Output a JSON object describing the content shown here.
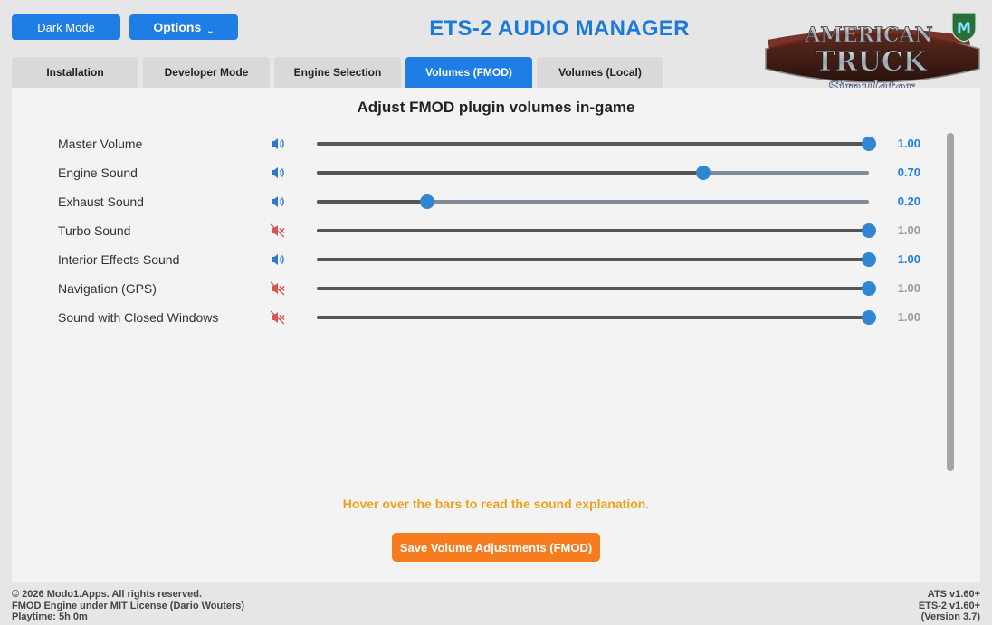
{
  "header": {
    "dark_mode_label": "Dark Mode",
    "options_label": "Options",
    "title": "ETS-2 AUDIO MANAGER",
    "logo": {
      "line1": "AMERICAN",
      "line2": "TRUCK",
      "line3": "Simulator",
      "badge": "M"
    }
  },
  "tabs": [
    {
      "label": "Installation",
      "active": false
    },
    {
      "label": "Developer Mode",
      "active": false
    },
    {
      "label": "Engine Selection",
      "active": false
    },
    {
      "label": "Volumes (FMOD)",
      "active": true
    },
    {
      "label": "Volumes (Local)",
      "active": false
    }
  ],
  "panel": {
    "title": "Adjust FMOD plugin volumes in-game",
    "rows": [
      {
        "label": "Master Volume",
        "value": 1.0,
        "display": "1.00",
        "enabled": true,
        "icon": "speaker-on-icon"
      },
      {
        "label": "Engine Sound",
        "value": 0.7,
        "display": "0.70",
        "enabled": true,
        "icon": "speaker-on-icon"
      },
      {
        "label": "Exhaust Sound",
        "value": 0.2,
        "display": "0.20",
        "enabled": true,
        "icon": "speaker-on-icon"
      },
      {
        "label": "Turbo Sound",
        "value": 1.0,
        "display": "1.00",
        "enabled": false,
        "icon": "speaker-muted-icon"
      },
      {
        "label": "Interior Effects Sound",
        "value": 1.0,
        "display": "1.00",
        "enabled": true,
        "icon": "speaker-on-icon"
      },
      {
        "label": "Navigation (GPS)",
        "value": 1.0,
        "display": "1.00",
        "enabled": false,
        "icon": "speaker-muted-icon"
      },
      {
        "label": "Sound with Closed Windows",
        "value": 1.0,
        "display": "1.00",
        "enabled": false,
        "icon": "speaker-muted-icon"
      }
    ],
    "hint": "Hover over the bars to read the sound explanation.",
    "save_label": "Save Volume Adjustments (FMOD)"
  },
  "footer": {
    "copyright": "© 2026 Modo1.Apps. All rights reserved.",
    "license": "FMOD Engine under MIT License (Dario Wouters)",
    "playtime": "Playtime: 5h 0m",
    "ats_version": "ATS v1.60+",
    "ets_version": "ETS-2 v1.60+",
    "app_version": "(Version 3.7)"
  },
  "colors": {
    "accent": "#1f7ee6",
    "save": "#f57d1f",
    "hint": "#f0a01e",
    "muted_icon": "#d9534f"
  }
}
